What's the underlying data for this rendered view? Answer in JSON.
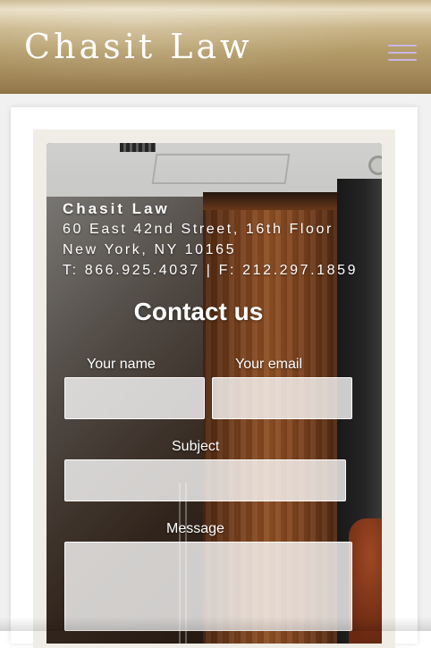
{
  "header": {
    "brand": "Chasit Law",
    "menu_icon": "hamburger-menu-icon",
    "colors": {
      "gold_top": "#e8ddc2",
      "gold_bottom": "#8f7548",
      "menu_icon": "#c9b6e6"
    }
  },
  "firm": {
    "name": "Chasit Law",
    "address_line1": "60 East 42nd Street, 16th Floor",
    "address_line2": "New York, NY 10165",
    "phones": "T: 866.925.4037 | F: 212.297.1859"
  },
  "contact_form": {
    "title": "Contact us",
    "name_label": "Your name",
    "name_value": "",
    "email_label": "Your email",
    "email_value": "",
    "subject_label": "Subject",
    "subject_value": "",
    "message_label": "Message",
    "message_value": ""
  }
}
